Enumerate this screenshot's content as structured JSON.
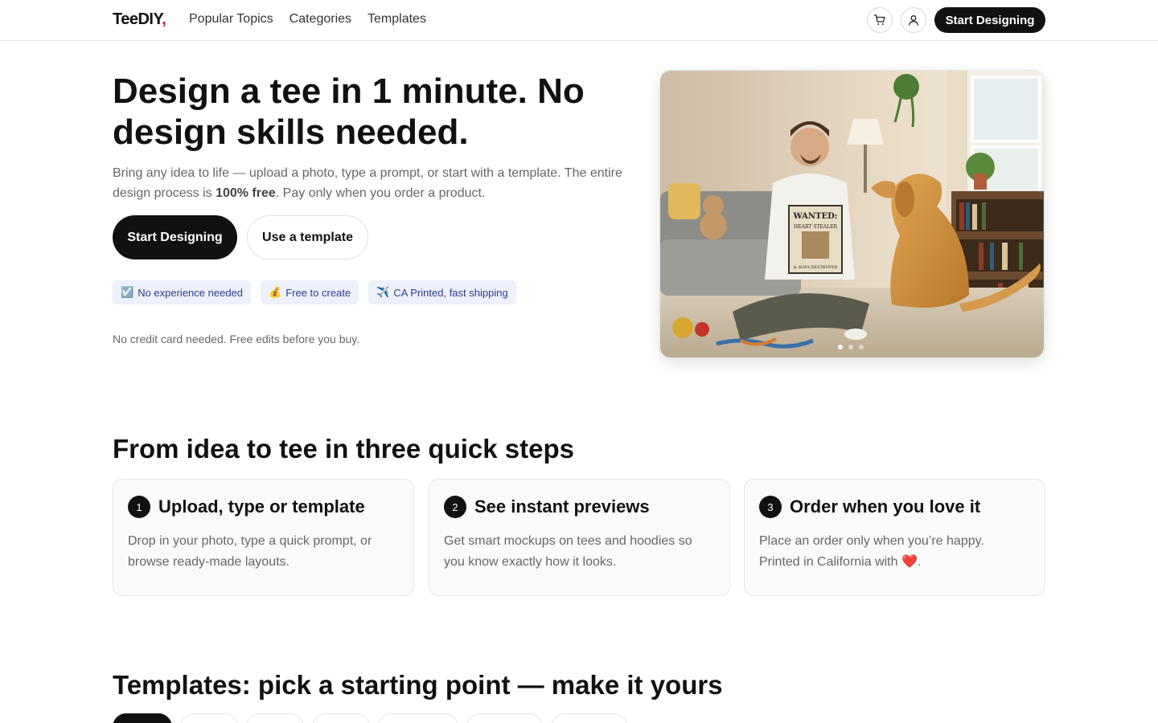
{
  "header": {
    "logo_main": "TeeDIY",
    "logo_accent": ",",
    "nav": [
      "Popular Topics",
      "Categories",
      "Templates"
    ],
    "cart_icon": "cart-icon",
    "user_icon": "user-icon",
    "cta": "Start Designing"
  },
  "hero": {
    "title": "Design a tee in 1 minute. No design skills needed.",
    "subtitle_before": "Bring any idea to life — upload a photo, type a prompt, or start with a template. The entire design process is ",
    "subtitle_bold": "100% free",
    "subtitle_after": ". Pay only when you order a product.",
    "primary_button": "Start Designing",
    "secondary_button": "Use a template",
    "chips": [
      {
        "emoji": "☑️",
        "label": "No experience needed"
      },
      {
        "emoji": "💰",
        "label": "Free to create"
      },
      {
        "emoji": "✈️",
        "label": "CA Printed, fast shipping"
      }
    ],
    "fineprint": "No credit card needed. Free edits before you buy.",
    "image": {
      "shirt_line1": "WANTED:",
      "shirt_line2": "HEART STEALER",
      "shirt_line3": "& SOFA DESTROYER",
      "carousel_active_index": 0,
      "carousel_count": 3
    }
  },
  "steps": {
    "title": "From idea to tee in three quick steps",
    "items": [
      {
        "number": "1",
        "title": "Upload, type or template",
        "text": "Drop in your photo, type a quick prompt, or browse ready-made layouts."
      },
      {
        "number": "2",
        "title": "See instant previews",
        "text": "Get smart mockups on tees and hoodies so you know exactly how it looks."
      },
      {
        "number": "3",
        "title": "Order when you love it",
        "text": "Place an order only when you’re happy. Printed in California with ",
        "emoji": "❤️",
        "text_end": "."
      }
    ]
  },
  "templates": {
    "title": "Templates: pick a starting point — make it yours"
  },
  "colors": {
    "primary": "#111111",
    "logo_accent": "#e11d2a",
    "chip_bg": "#eef1fb",
    "chip_text": "#2a3b8f"
  }
}
